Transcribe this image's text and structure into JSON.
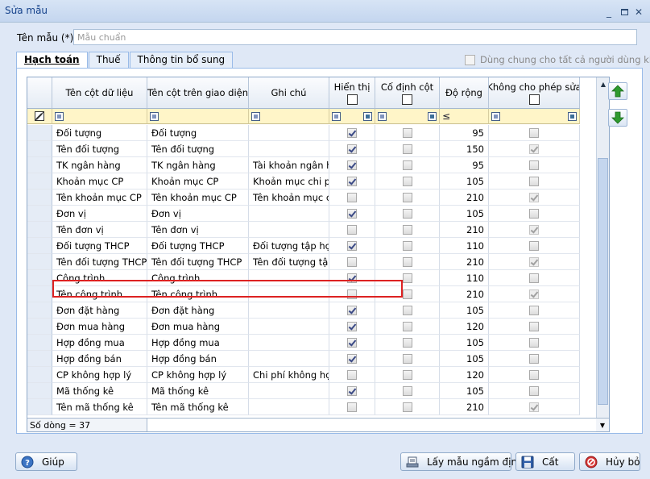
{
  "window": {
    "title": "Sửa mẫu"
  },
  "form": {
    "name_label": "Tên mẫu (*)",
    "name_placeholder": "Mẫu chuẩn"
  },
  "tabs": [
    {
      "label": "Hạch toán",
      "active": true
    },
    {
      "label": "Thuế",
      "active": false
    },
    {
      "label": "Thông tin bổ sung",
      "active": false
    }
  ],
  "share_label": "Dùng chung cho tất cả người dùng khác",
  "grid": {
    "headers": {
      "data_col": "Tên cột dữ liệu",
      "ui_col": "Tên cột trên giao diện",
      "note": "Ghi chú",
      "show": "Hiển thị",
      "fixed": "Cố định cột",
      "width": "Độ rộng",
      "no_edit": "Không cho phép sửa"
    },
    "filter_width_op": "≤",
    "rows": [
      {
        "data": "Đối tượng",
        "ui": "Đối tượng",
        "note": "",
        "show": true,
        "fixed": false,
        "width": "95",
        "no_edit": false
      },
      {
        "data": "Tên đối tượng",
        "ui": "Tên đối tượng",
        "note": "",
        "show": true,
        "fixed": false,
        "width": "150",
        "no_edit": true
      },
      {
        "data": "TK ngân hàng",
        "ui": "TK ngân hàng",
        "note": "Tài khoản ngân h",
        "show": true,
        "fixed": false,
        "width": "95",
        "no_edit": false
      },
      {
        "data": "Khoản mục CP",
        "ui": "Khoản mục CP",
        "note": "Khoản mục chi ph",
        "show": true,
        "fixed": false,
        "width": "105",
        "no_edit": false
      },
      {
        "data": "Tên khoản mục CP",
        "ui": "Tên khoản mục CP",
        "note": "Tên khoản mục c",
        "show": false,
        "fixed": false,
        "width": "210",
        "no_edit": true
      },
      {
        "data": "Đơn vị",
        "ui": "Đơn vị",
        "note": "",
        "show": true,
        "fixed": false,
        "width": "105",
        "no_edit": false
      },
      {
        "data": "Tên đơn vị",
        "ui": "Tên đơn vị",
        "note": "",
        "show": false,
        "fixed": false,
        "width": "210",
        "no_edit": true
      },
      {
        "data": "Đối tượng THCP",
        "ui": "Đối tượng THCP",
        "note": "Đối tượng tập hợp",
        "show": true,
        "fixed": false,
        "width": "110",
        "no_edit": false
      },
      {
        "data": "Tên đối tượng THCP",
        "ui": "Tên đối tượng THCP",
        "note": "Tên đối tượng tập",
        "show": false,
        "fixed": false,
        "width": "210",
        "no_edit": true
      },
      {
        "data": "Công trình",
        "ui": "Công trình",
        "note": "",
        "show": true,
        "fixed": false,
        "width": "110",
        "no_edit": false
      },
      {
        "data": "Tên công trình",
        "ui": "Tên công trình",
        "note": "",
        "show": false,
        "fixed": false,
        "width": "210",
        "no_edit": true
      },
      {
        "data": "Đơn đặt hàng",
        "ui": "Đơn đặt hàng",
        "note": "",
        "show": true,
        "fixed": false,
        "width": "105",
        "no_edit": false
      },
      {
        "data": "Đơn mua hàng",
        "ui": "Đơn mua hàng",
        "note": "",
        "show": true,
        "fixed": false,
        "width": "120",
        "no_edit": false
      },
      {
        "data": "Hợp đồng mua",
        "ui": "Hợp đồng mua",
        "note": "",
        "show": true,
        "fixed": false,
        "width": "105",
        "no_edit": false
      },
      {
        "data": "Hợp đồng bán",
        "ui": "Hợp đồng bán",
        "note": "",
        "show": true,
        "fixed": false,
        "width": "105",
        "no_edit": false
      },
      {
        "data": "CP không hợp lý",
        "ui": "CP không hợp lý",
        "note": "Chi phí không hợp",
        "show": false,
        "fixed": false,
        "width": "120",
        "no_edit": false
      },
      {
        "data": "Mã thống kê",
        "ui": "Mã thống kê",
        "note": "",
        "show": true,
        "fixed": false,
        "width": "105",
        "no_edit": false
      },
      {
        "data": "Tên mã thống kê",
        "ui": "Tên mã thống kê",
        "note": "",
        "show": false,
        "fixed": false,
        "width": "210",
        "no_edit": true
      }
    ],
    "footer_count": "Số dòng = 37"
  },
  "buttons": {
    "help": "Giúp",
    "default_template": "Lấy mẫu ngầm định",
    "save": "Cất",
    "cancel": "Hủy bỏ"
  },
  "colors": {
    "selection_outline": "#dd2222",
    "filter_row": "#fff5c8",
    "arrow_green": "#2e9a2e"
  }
}
